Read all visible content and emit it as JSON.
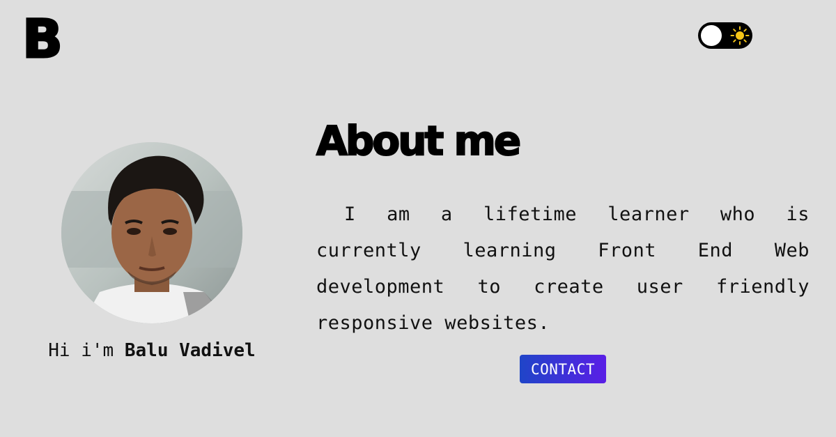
{
  "header": {
    "logo_letter": "B",
    "theme_toggle": {
      "state": "light",
      "icon": "sun-icon",
      "sun_color": "#f5c518"
    }
  },
  "profile": {
    "avatar_icon": "profile-photo",
    "greeting_prefix": "Hi i'm ",
    "name": "Balu Vadivel"
  },
  "about": {
    "title": "About me",
    "text": "I am a lifetime learner who is currently learning Front End Web development to create user friendly responsive websites.",
    "contact_label": "CONTACT"
  },
  "colors": {
    "background": "#dedede",
    "button_gradient_start": "#1f45c8",
    "button_gradient_end": "#5a1ee6"
  }
}
